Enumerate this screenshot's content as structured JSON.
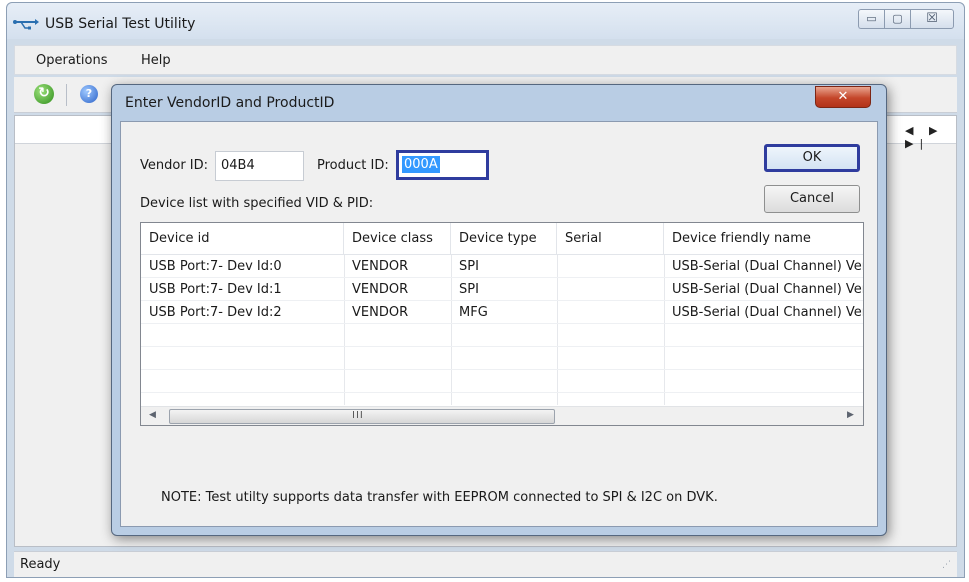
{
  "window": {
    "title": "USB Serial Test Utility",
    "controls": {
      "minimize": "▭",
      "maximize": "▢",
      "close": "☒"
    }
  },
  "menu": {
    "items": [
      "Operations",
      "Help"
    ]
  },
  "toolbar": {
    "refresh_icon": "refresh-icon",
    "help_icon": "help-icon",
    "refresh_glyph": "↻",
    "help_glyph": "?"
  },
  "client": {
    "nav_glyphs": "◀ ▶ ▶|"
  },
  "status": {
    "text": "Ready"
  },
  "dialog": {
    "title": "Enter VendorID and ProductID",
    "close_glyph": "✕",
    "vendor_label": "Vendor ID:",
    "vendor_value": "04B4",
    "product_label": "Product ID:",
    "product_value": "000A",
    "ok_label": "OK",
    "cancel_label": "Cancel",
    "list_label": "Device list with specified VID & PID:",
    "columns": [
      "Device id",
      "Device class",
      "Device type",
      "Serial",
      "Device friendly name"
    ],
    "rows": [
      [
        "USB Port:7- Dev Id:0",
        "VENDOR",
        "SPI",
        "",
        "USB-Serial (Dual Channel) Ver"
      ],
      [
        "USB Port:7- Dev Id:1",
        "VENDOR",
        "SPI",
        "",
        "USB-Serial (Dual Channel) Ver"
      ],
      [
        "USB Port:7- Dev Id:2",
        "VENDOR",
        "MFG",
        "",
        "USB-Serial (Dual Channel) Ver"
      ]
    ],
    "scroll_left": "◀",
    "scroll_right": "▶",
    "scroll_grip": "III",
    "note": "NOTE: Test utilty supports data transfer with EEPROM connected to SPI & I2C on DVK."
  },
  "colors": {
    "focus_border": "#2f3c9e",
    "selection": "#3399ff",
    "close_red": "#c4462a"
  }
}
